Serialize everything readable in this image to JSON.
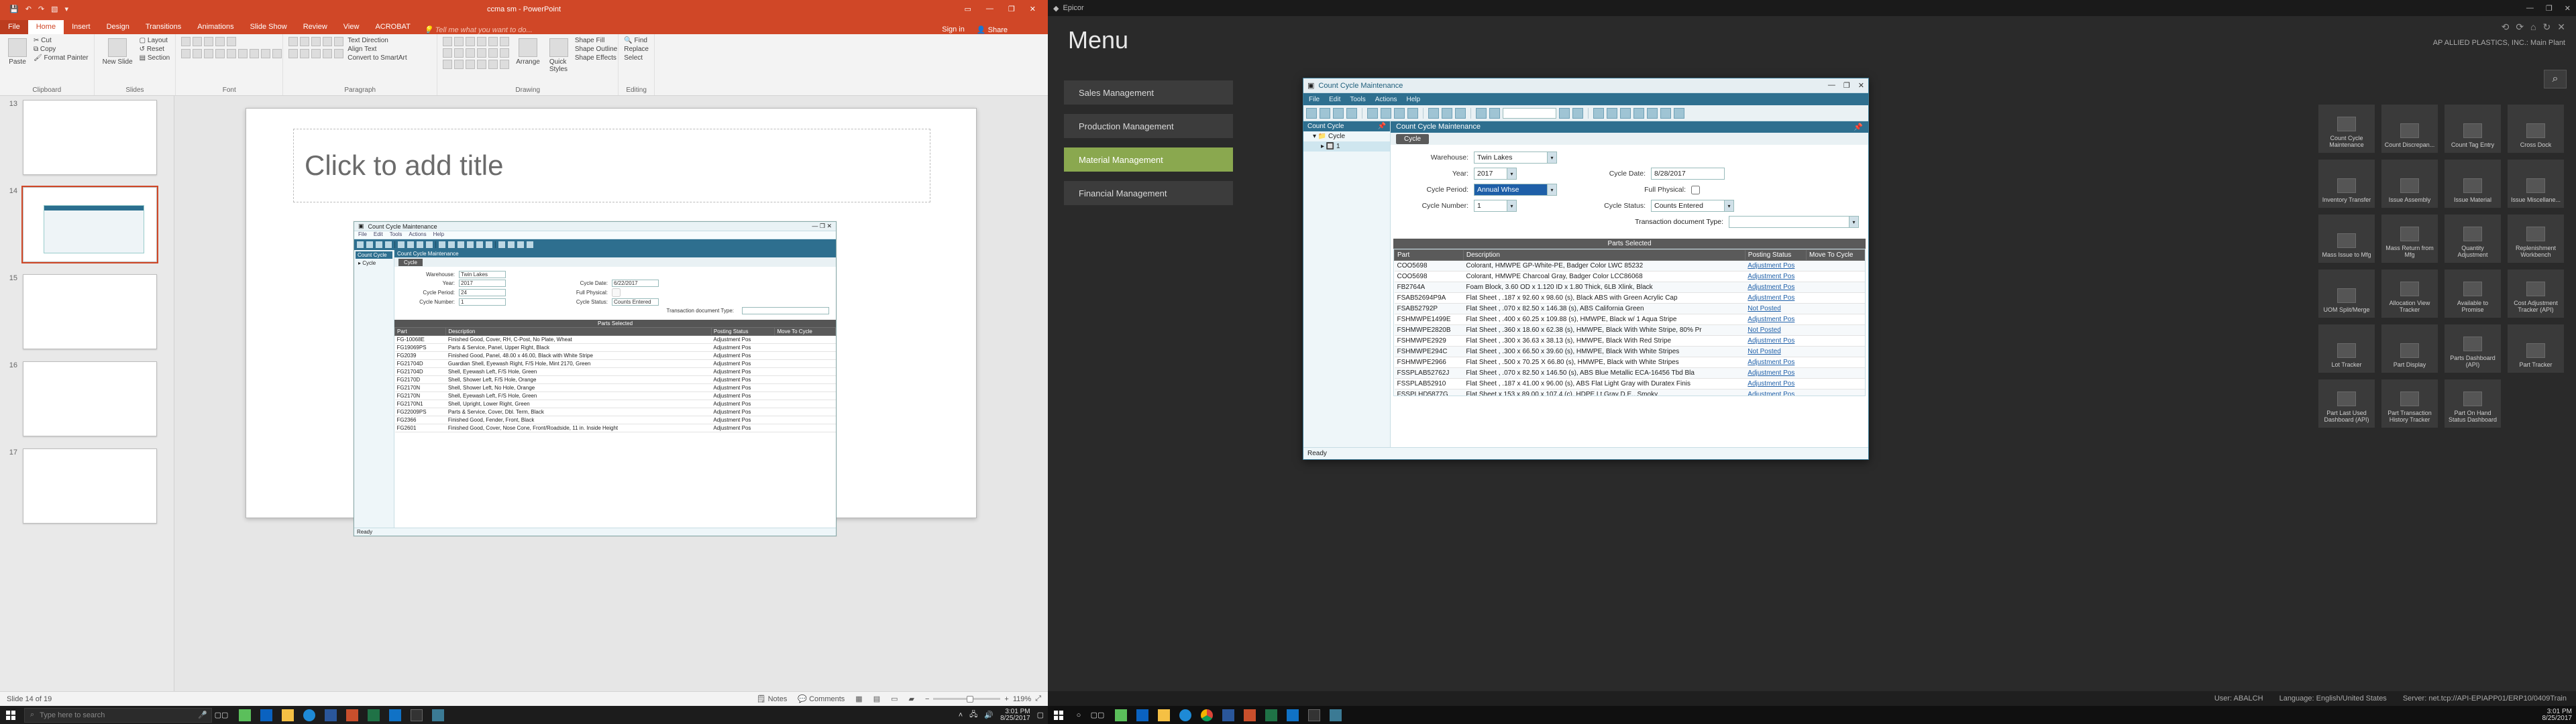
{
  "left": {
    "titlebar": {
      "title": "ccma sm - PowerPoint"
    },
    "tabs": {
      "file": "File",
      "home": "Home",
      "insert": "Insert",
      "design": "Design",
      "transitions": "Transitions",
      "animations": "Animations",
      "slideshow": "Slide Show",
      "review": "Review",
      "view": "View",
      "acrobat": "ACROBAT",
      "tellme": "Tell me what you want to do...",
      "signin": "Sign in",
      "share": "Share"
    },
    "ribbon": {
      "clipboard": {
        "label": "Clipboard",
        "paste": "Paste",
        "cut": "Cut",
        "copy": "Copy",
        "painter": "Format Painter"
      },
      "slides": {
        "label": "Slides",
        "new": "New\nSlide",
        "layout": "Layout",
        "reset": "Reset",
        "section": "Section"
      },
      "font": {
        "label": "Font"
      },
      "paragraph": {
        "label": "Paragraph",
        "direction": "Text Direction",
        "align": "Align Text",
        "smartart": "Convert to SmartArt"
      },
      "drawing": {
        "label": "Drawing",
        "arrange": "Arrange",
        "quick": "Quick\nStyles",
        "fill": "Shape Fill",
        "outline": "Shape Outline",
        "effects": "Shape Effects"
      },
      "editing": {
        "label": "Editing",
        "find": "Find",
        "replace": "Replace",
        "select": "Select"
      }
    },
    "thumbs": [
      {
        "n": "13"
      },
      {
        "n": "14",
        "sel": true
      },
      {
        "n": "15"
      },
      {
        "n": "16"
      },
      {
        "n": "17"
      }
    ],
    "slide": {
      "title_placeholder": "Click to add title",
      "embed": {
        "title": "Count Cycle Maintenance",
        "menus": [
          "File",
          "Edit",
          "Tools",
          "Actions",
          "Help"
        ],
        "tree_hdr": "Count Cycle",
        "tree_node": "Cycle",
        "tab": "Count Cycle Maintenance",
        "subtab": "Cycle",
        "form": {
          "warehouse_l": "Warehouse:",
          "warehouse_v": "Twin Lakes",
          "year_l": "Year:",
          "year_v": "2017",
          "cycleperiod_l": "Cycle Period:",
          "cycleperiod_v": "24",
          "cyclenum_l": "Cycle Number:",
          "cyclenum_v": "1",
          "cycledate_l": "Cycle Date:",
          "cycledate_v": "6/22/2017",
          "fullphys_l": "Full Physical:",
          "cyclestatus_l": "Cycle Status:",
          "cyclestatus_v": "Counts Entered",
          "txdoc_l": "Transaction document Type:"
        },
        "grid_title": "Parts Selected",
        "cols": [
          "Part",
          "Description",
          "Posting Status",
          "Move To Cycle"
        ],
        "rows": [
          [
            "FG-10068E",
            "Finished Good, Cover, RH, C-Post, No Plate, Wheat",
            "Adjustment Pos",
            ""
          ],
          [
            "FG19069PS",
            "Parts & Service, Panel, Upper Right, Black",
            "Adjustment Pos",
            ""
          ],
          [
            "FG2039",
            "Finished Good, Panel, 48.00 x 46.00, Black with White Stripe",
            "Adjustment Pos",
            ""
          ],
          [
            "FG21704D",
            "Guardian Shell, Eyewash Right, F/S Hole, Mint 2170, Green",
            "Adjustment Pos",
            ""
          ],
          [
            "FG21704D",
            "Shell, Eyewash Left, F/S Hole, Green",
            "Adjustment Pos",
            ""
          ],
          [
            "FG2170D",
            "Shell, Shower Left, F/S Hole, Orange",
            "Adjustment Pos",
            ""
          ],
          [
            "FG2170N",
            "Shell, Shower Left, No Hole, Orange",
            "Adjustment Pos",
            ""
          ],
          [
            "FG2170N",
            "Shell, Eyewash Left, F/S Hole, Green",
            "Adjustment Pos",
            ""
          ],
          [
            "FG2170N1",
            "Shell, Upright, Lower Right, Green",
            "Adjustment Pos",
            ""
          ],
          [
            "FG22009PS",
            "Parts & Service, Cover, Dbl. Term, Black",
            "Adjustment Pos",
            ""
          ],
          [
            "FG2366",
            "Finished Good, Fender, Front, Black",
            "Adjustment Pos",
            ""
          ],
          [
            "FG2601",
            "Finished Good, Cover, Nose Cone, Front/Roadside, 11 in. Inside Height",
            "Adjustment Pos",
            ""
          ]
        ],
        "status": "Ready"
      }
    },
    "status": {
      "slide": "Slide 14 of 19",
      "lang": "",
      "notes": "Notes",
      "comments": "Comments",
      "zoom": "119%"
    },
    "taskbar": {
      "search_ph": "Type here to search",
      "time": "3:01 PM",
      "date": "8/25/2017"
    }
  },
  "right": {
    "titlebar": {
      "title": "Epicor"
    },
    "header": {
      "menu": "Menu",
      "plant": "AP ALLIED PLASTICS, INC.: Main Plant"
    },
    "side": {
      "items": [
        {
          "label": "Sales Management"
        },
        {
          "label": "Production Management"
        },
        {
          "label": "Material Management",
          "active": true
        },
        {
          "label": "Financial Management"
        }
      ]
    },
    "tiles": [
      "Count Cycle Maintenance",
      "Count Discrepan...",
      "Count Tag Entry",
      "Cross Dock",
      "Inventory Transfer",
      "Issue Assembly",
      "Issue Material",
      "Issue Miscellane...",
      "Mass Issue to Mfg",
      "Mass Return from Mfg",
      "Quantity Adjustment",
      "Replenishment Workbench",
      "UOM Split/Merge",
      "Allocation View Tracker",
      "Available to Promise",
      "Cost Adjustment Tracker (API)",
      "Lot Tracker",
      "Part Display",
      "Parts Dashboard (API)",
      "Part Tracker",
      "Part Last Used Dashboard (API)",
      "Part Transaction History Tracker",
      "Part On Hand Status Dashboard",
      ""
    ],
    "window": {
      "title": "Count Cycle Maintenance",
      "menus": [
        "File",
        "Edit",
        "Tools",
        "Actions",
        "Help"
      ],
      "tree_hdr": "Count Cycle",
      "tree_node": "Cycle",
      "tree_sub": "1",
      "tab": "Count Cycle Maintenance",
      "subtab": "Cycle",
      "form": {
        "warehouse_l": "Warehouse:",
        "warehouse_v": "Twin Lakes",
        "year_l": "Year:",
        "year_v": "2017",
        "cycleperiod_l": "Cycle Period:",
        "cycleperiod_v": "Annual Whse",
        "cyclenum_l": "Cycle Number:",
        "cyclenum_v": "1",
        "cycledate_l": "Cycle Date:",
        "cycledate_v": "8/28/2017",
        "fullphys_l": "Full Physical:",
        "cyclestatus_l": "Cycle Status:",
        "cyclestatus_v": "Counts Entered",
        "txdoc_l": "Transaction document Type:"
      },
      "grid_title": "Parts Selected",
      "cols": [
        "Part",
        "Description",
        "Posting Status",
        "Move To Cycle"
      ],
      "rows": [
        [
          "COO5698",
          "Colorant, HMWPE GP-White-PE, Badger Color LWC 85232",
          "Adjustment Pos",
          ""
        ],
        [
          "COO5698",
          "Colorant, HMWPE Charcoal Gray, Badger Color LCC86068",
          "Adjustment Pos",
          ""
        ],
        [
          "FB2764A",
          "Foam Block, 3.60 OD x 1.120 ID x 1.80 Thick, 6LB Xlink, Black",
          "Adjustment Pos",
          ""
        ],
        [
          "FSAB52694P9A",
          "Flat Sheet , .187 x 92.60 x 98.60 (s), Black ABS with Green Acrylic Cap",
          "Adjustment Pos",
          ""
        ],
        [
          "FSAB52792P",
          "Flat Sheet , .070 x 82.50 x 146.38 (s), ABS California Green",
          "Not Posted",
          ""
        ],
        [
          "FSHMWPE1499E",
          "Flat Sheet , .400 x 60.25 x 109.88 (s), HMWPE, Black w/ 1 Aqua Stripe",
          "Adjustment Pos",
          ""
        ],
        [
          "FSHMWPE2820B",
          "Flat Sheet , .360 x 18.60 x 62.38 (s), HMWPE, Black With White Stripe, 80% Pr",
          "Not Posted",
          ""
        ],
        [
          "FSHMWPE2929",
          "Flat Sheet , .300 x 36.63 x 38.13 (s), HMWPE, Black With Red Stripe",
          "Adjustment Pos",
          ""
        ],
        [
          "FSHMWPE294C",
          "Flat Sheet , .300 x 66.50 x 39.60 (s), HMWPE, Black With White Stripes",
          "Not Posted",
          ""
        ],
        [
          "FSHMWPE2966",
          "Flat Sheet , .500 x 70.25 X 66.80 (s), HMWPE, Black with White Stripes",
          "Adjustment Pos",
          ""
        ],
        [
          "FSSPLAB52762J",
          "Flat Sheet , .070 x 82.50 x 146.50 (s), ABS Blue Metallic ECA-16456 Tbd Bla",
          "Adjustment Pos",
          ""
        ],
        [
          "FSSPLAB52910",
          "Flat Sheet , .187 x 41.00 x 96.00 (s), ABS Flat Light Gray with Duratex Finis",
          "Adjustment Pos",
          ""
        ],
        [
          "FSSPLHD5877G",
          "Flat Sheet x 153 x 89.00 x 107.4 (c), HDPE Lt Gray D.E., Smoky",
          "Adjustment Pos",
          ""
        ]
      ],
      "status": "Ready"
    },
    "footer": {
      "user_l": "User:",
      "user_v": "ABALCH",
      "lang_l": "Language:",
      "lang_v": "English/United States",
      "srv_l": "Server:",
      "srv_v": "net.tcp://API-EPIAPP01/ERP10/0409Train"
    },
    "taskbar": {
      "time": "3:01 PM",
      "date": "8/25/2017"
    }
  }
}
